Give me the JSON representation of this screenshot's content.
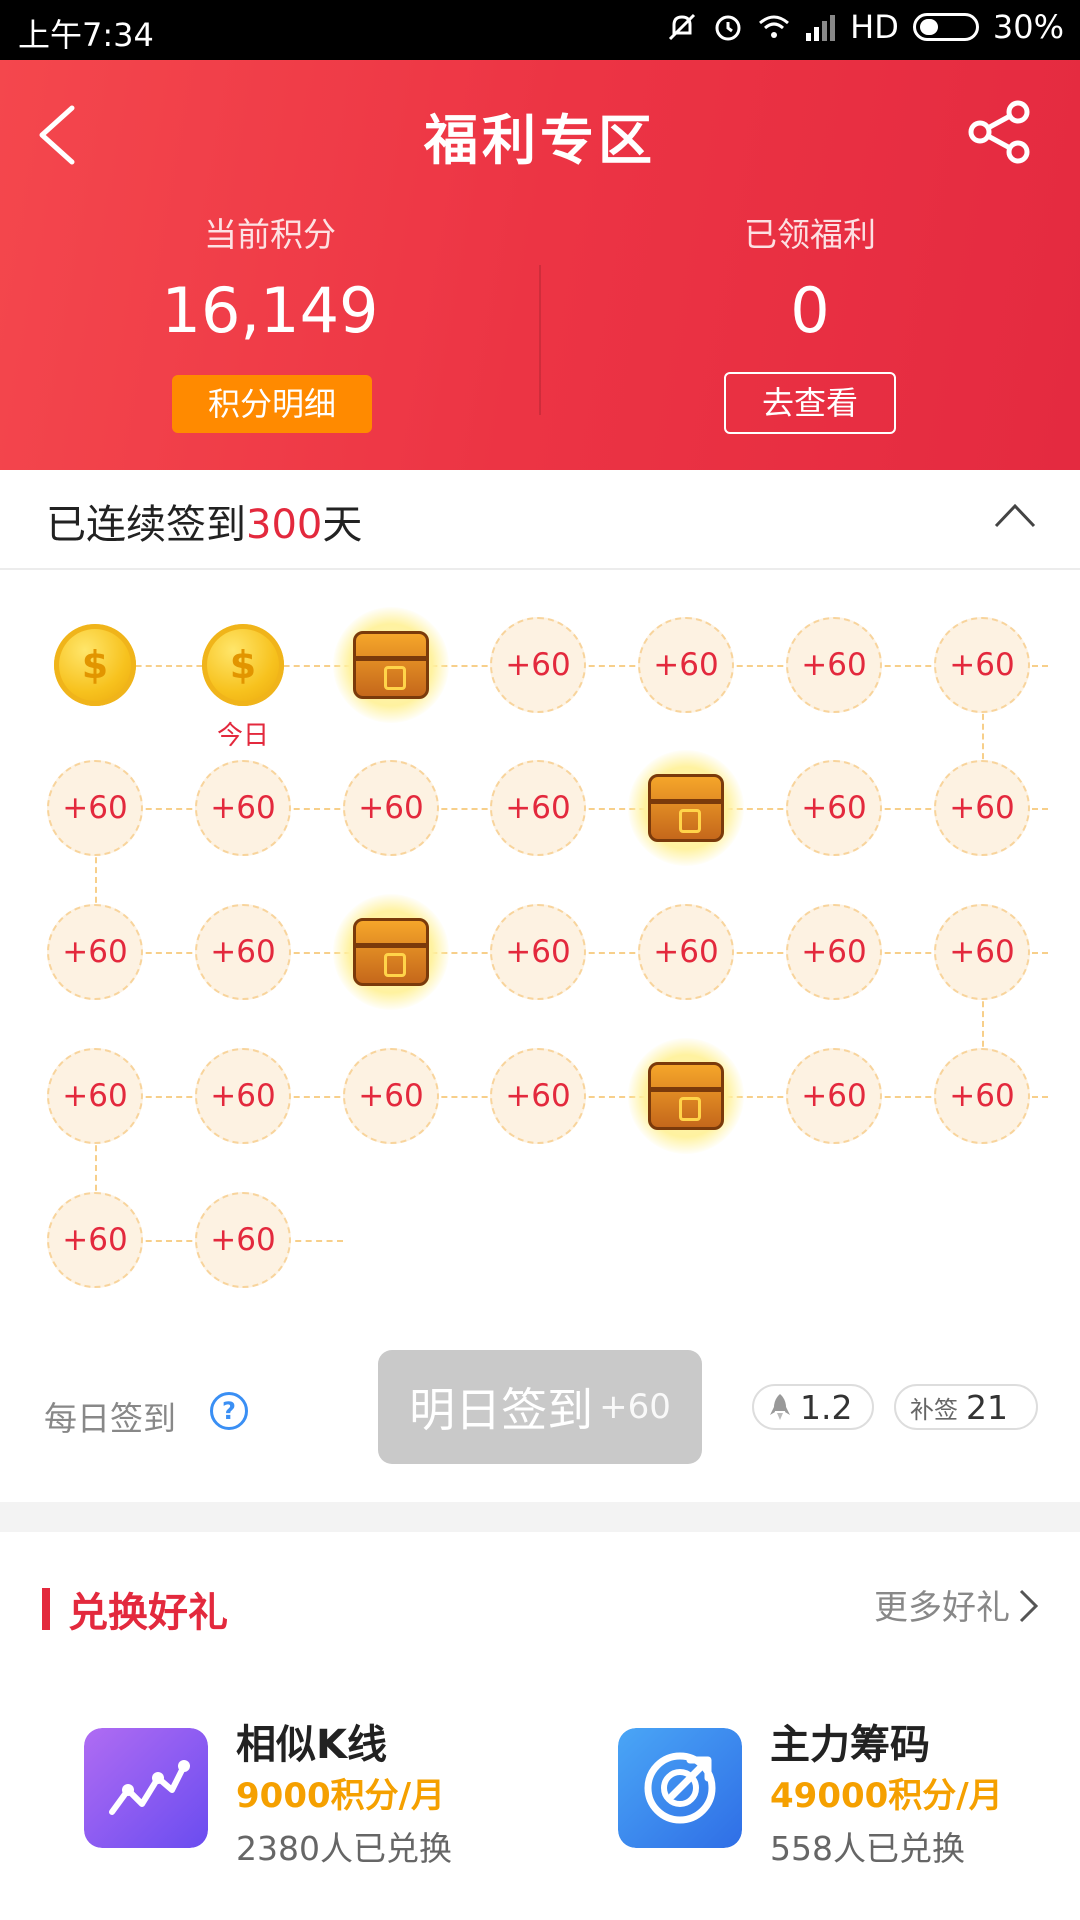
{
  "status_bar": {
    "time": "上午7:34",
    "network": "HD",
    "battery": "30%"
  },
  "header": {
    "title": "福利专区",
    "points_label": "当前积分",
    "points_value": "16,149",
    "points_button": "积分明细",
    "benefits_label": "已领福利",
    "benefits_value": "0",
    "benefits_button": "去查看"
  },
  "streak": {
    "prefix": "已连续签到",
    "days": "300",
    "suffix": "天"
  },
  "checkin_grid": {
    "today_label": "今日",
    "reward_label": "+60",
    "rows": [
      [
        "coin",
        "coin",
        "chest",
        "+60",
        "+60",
        "+60",
        "+60"
      ],
      [
        "+60",
        "+60",
        "+60",
        "+60",
        "chest",
        "+60",
        "+60"
      ],
      [
        "+60",
        "+60",
        "chest",
        "+60",
        "+60",
        "+60",
        "+60"
      ],
      [
        "+60",
        "+60",
        "+60",
        "+60",
        "chest",
        "+60",
        "+60"
      ],
      [
        "+60",
        "+60"
      ]
    ]
  },
  "daily_checkin": {
    "label": "每日签到",
    "help": "?",
    "button_text": "明日签到",
    "button_reward": "+60",
    "multiplier": "1.2",
    "makeup_label": "补签",
    "makeup_count": "21"
  },
  "exchange": {
    "title": "兑换好礼",
    "more": "更多好礼",
    "items": [
      {
        "name": "相似K线",
        "price": "9000积分/月",
        "count": "2380人已兑换",
        "icon": "kline-chart-icon",
        "color": "#8a55f2"
      },
      {
        "name": "主力筹码",
        "price": "49000积分/月",
        "count": "558人已兑换",
        "icon": "chip-target-icon",
        "color": "#3d8bf0"
      }
    ]
  },
  "colors": {
    "brand_red": "#e3293d",
    "orange": "#ff8a00",
    "gold_text": "#f5a000"
  }
}
